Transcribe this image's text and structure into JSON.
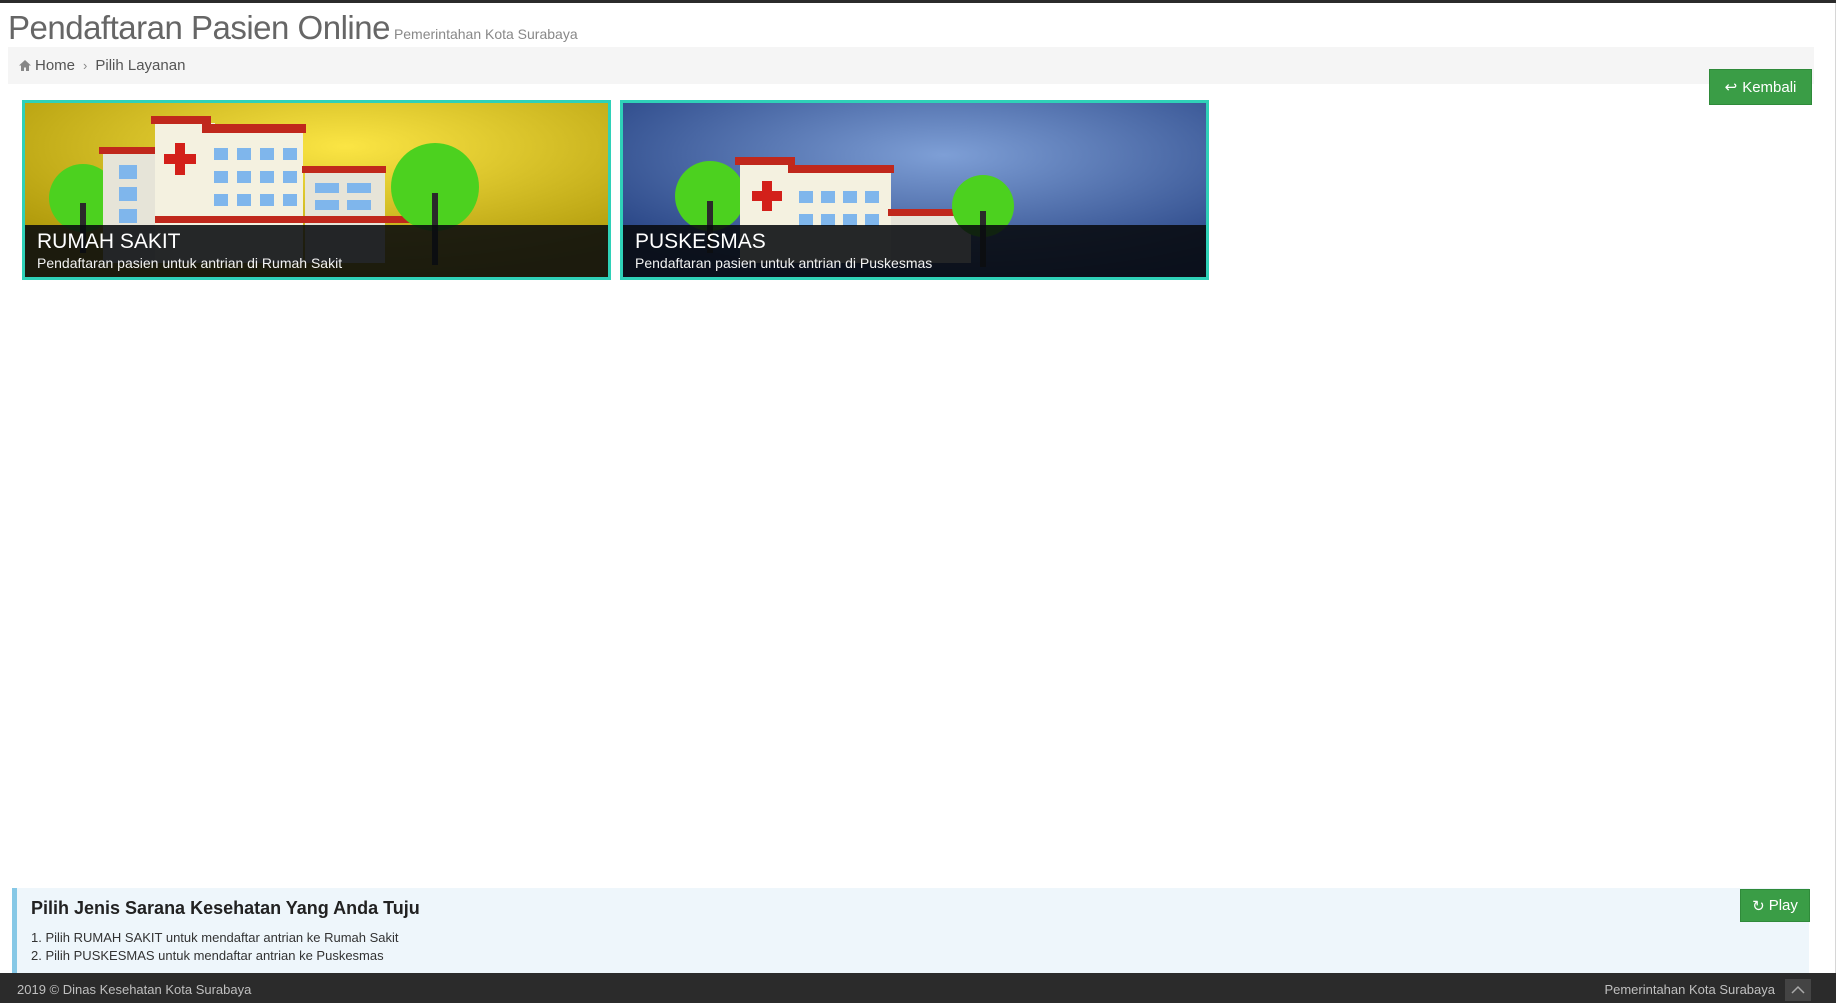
{
  "header": {
    "title": "Pendaftaran Pasien Online",
    "subtitle": "Pemerintahan Kota Surabaya"
  },
  "breadcrumb": {
    "home_label": "Home",
    "current_label": "Pilih Layanan"
  },
  "actions": {
    "back_label": "Kembali",
    "play_label": "Play"
  },
  "services": [
    {
      "title": "RUMAH SAKIT",
      "description": "Pendaftaran pasien untuk antrian di Rumah Sakit"
    },
    {
      "title": "PUSKESMAS",
      "description": "Pendaftaran pasien untuk antrian di Puskesmas"
    }
  ],
  "info": {
    "title": "Pilih Jenis Sarana Kesehatan Yang Anda Tuju",
    "lines": [
      "1. Pilih RUMAH SAKIT untuk mendaftar antrian ke Rumah Sakit",
      "2. Pilih PUSKESMAS untuk mendaftar antrian ke Puskesmas"
    ]
  },
  "footer": {
    "copyright": "2019 © Dinas Kesehatan Kota Surabaya",
    "right_text": "Pemerintahan Kota Surabaya"
  },
  "colors": {
    "accent_green": "#3a9d46",
    "card_border": "#2fd1b8",
    "card1_bg": "#d8b81c",
    "card2_bg": "#3a5a98",
    "footer_bg": "#2b2b2b",
    "info_bg": "#eef6fb"
  },
  "icons": {
    "home": "home-icon",
    "breadcrumb_separator": "chevron-right-icon",
    "back": "reply-icon",
    "play": "refresh-icon",
    "scroll_top": "chevron-up-icon"
  }
}
